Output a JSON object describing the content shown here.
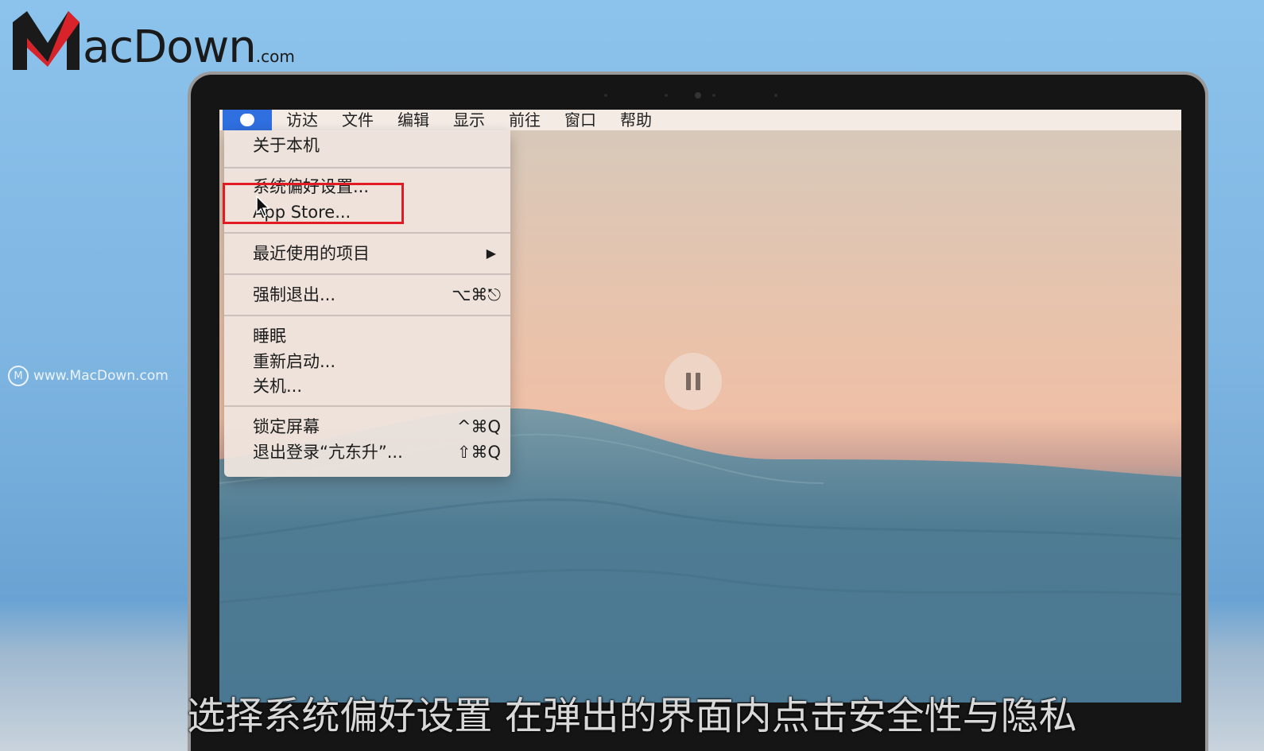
{
  "brand": {
    "logo_text": "acDown",
    "logo_suffix": ".com",
    "watermark": "www.MacDown.com"
  },
  "menubar": {
    "items": [
      "访达",
      "文件",
      "编辑",
      "显示",
      "前往",
      "窗口",
      "帮助"
    ]
  },
  "apple_menu": {
    "about": "关于本机",
    "system_prefs": "系统偏好设置...",
    "app_store": "App Store...",
    "recent_items": "最近使用的项目",
    "recent_arrow": "▶",
    "force_quit": "强制退出...",
    "force_quit_shortcut": "⌥⌘⎋",
    "sleep": "睡眠",
    "restart": "重新启动...",
    "shutdown": "关机...",
    "lock_screen": "锁定屏幕",
    "lock_screen_shortcut": "^⌘Q",
    "logout": "退出登录“亢东升”...",
    "logout_shortcut": "⇧⌘Q"
  },
  "subtitle": "选择系统偏好设置 在弹出的界面内点击安全性与隐私",
  "colors": {
    "highlight": "#e01b24",
    "apple_tab": "#2f6fe0"
  }
}
